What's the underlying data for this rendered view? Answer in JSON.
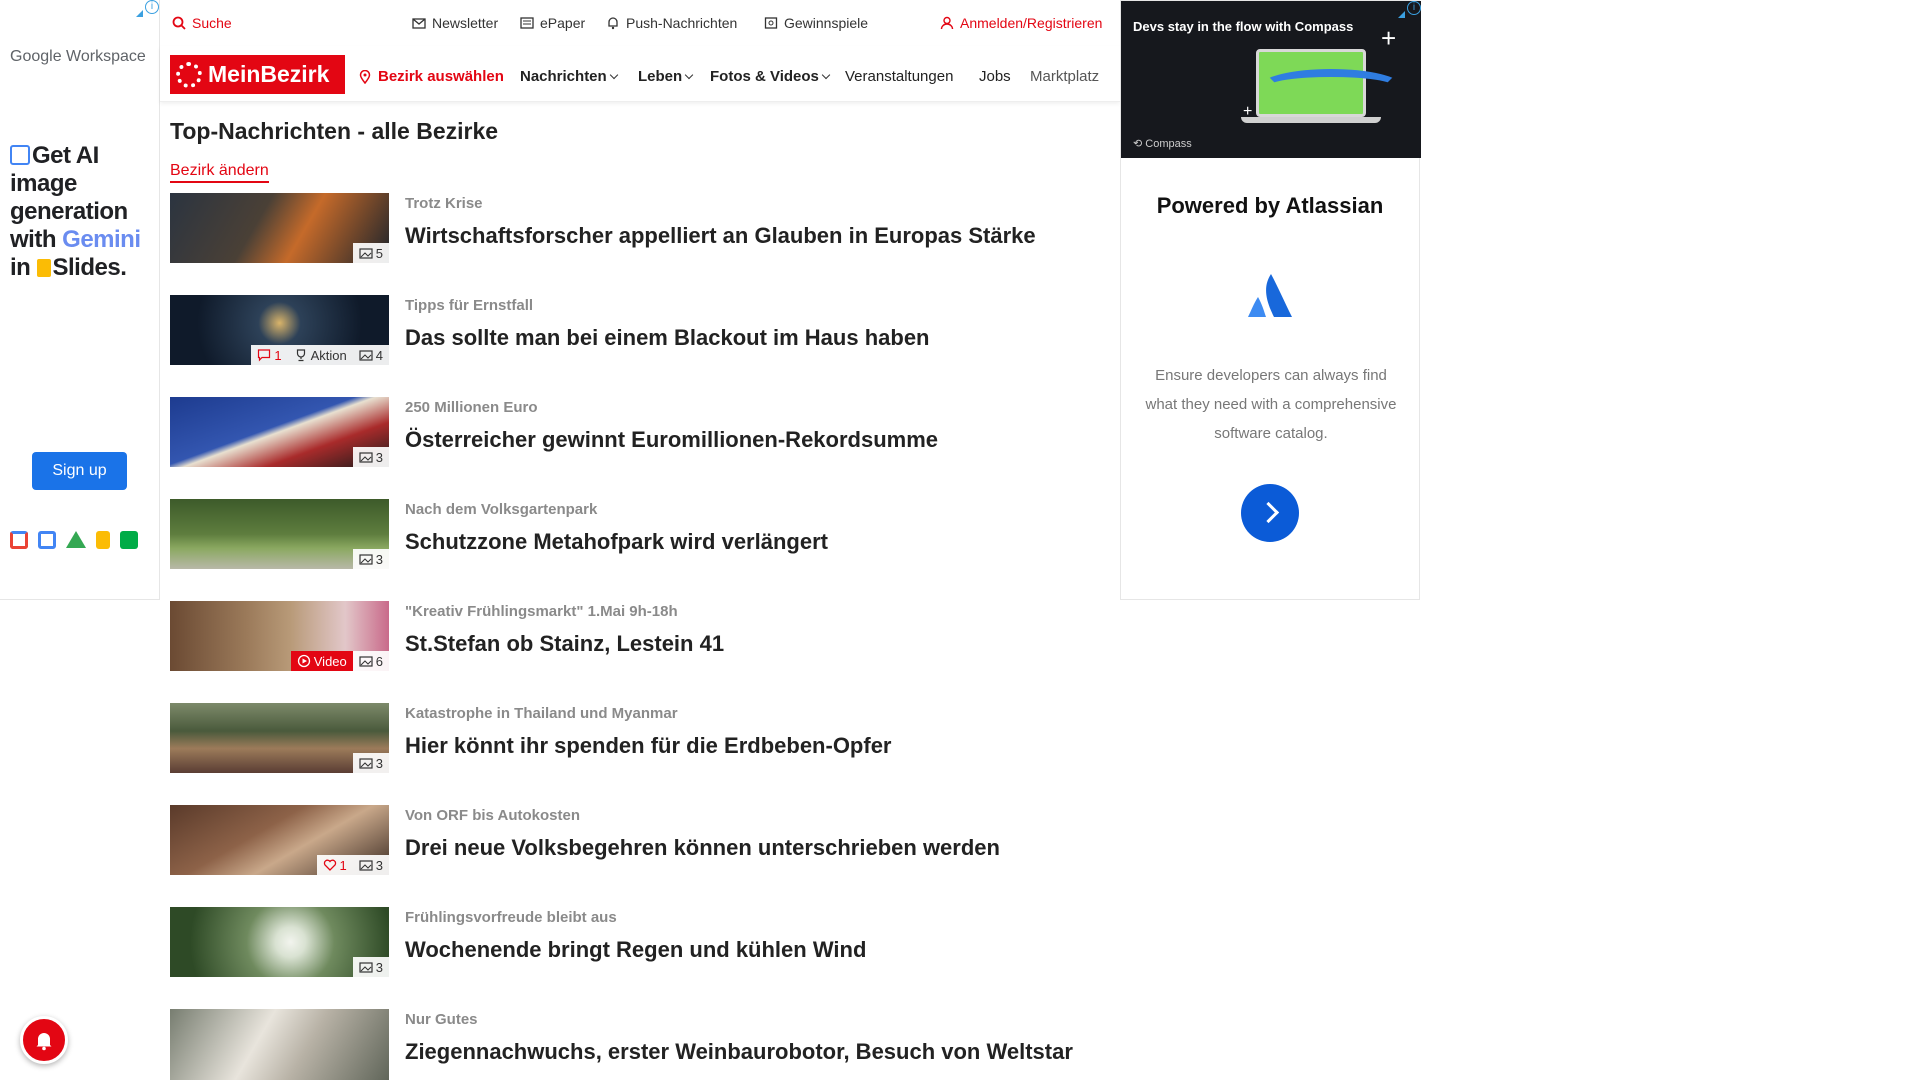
{
  "left_ad": {
    "brand": "Google Workspace",
    "headline_parts": [
      "Get AI image generation with ",
      "Gemini",
      " in ",
      "Slides."
    ],
    "cta": "Sign up",
    "apps": [
      "gmail",
      "calendar",
      "drive",
      "keep",
      "meet"
    ]
  },
  "topbar": {
    "search": "Suche",
    "newsletter": "Newsletter",
    "epaper": "ePaper",
    "push": "Push-Nachrichten",
    "games": "Gewinnspiele",
    "login": "Anmelden/Registrieren"
  },
  "nav": {
    "brand": "MeinBezirk",
    "district": "Bezirk auswählen",
    "items": [
      "Nachrichten",
      "Leben",
      "Fotos & Videos",
      "Veranstaltungen",
      "Jobs",
      "Marktplatz"
    ]
  },
  "page": {
    "title": "Top-Nachrichten - alle Bezirke",
    "change_link": "Bezirk ändern"
  },
  "articles": [
    {
      "kicker": "Trotz Krise",
      "headline": "Wirtschaftsforscher appelliert an Glauben in Europas Stärke",
      "photos": "5",
      "thumb_colors": [
        "#2b3440",
        "#c56a2a"
      ]
    },
    {
      "kicker": "Tipps für Ernstfall",
      "headline": "Das sollte man bei einem Blackout im Haus haben",
      "comments": "1",
      "action": "Aktion",
      "photos": "4",
      "thumb_colors": [
        "#0f1a2a",
        "#2d4158"
      ]
    },
    {
      "kicker": "250 Millionen Euro",
      "headline": "Österreicher gewinnt Euromillionen-Rekordsumme",
      "photos": "3",
      "thumb_colors": [
        "#1d3b8f",
        "#a92b2b"
      ]
    },
    {
      "kicker": "Nach dem Volksgartenpark",
      "headline": "Schutzzone Metahofpark wird verlängert",
      "photos": "3",
      "thumb_colors": [
        "#3d5a2a",
        "#8aa860"
      ]
    },
    {
      "kicker": "\"Kreativ Frühlingsmarkt\" 1.Mai 9h-18h",
      "headline": "St.Stefan ob Stainz, Lestein 41",
      "video": "Video",
      "photos": "6",
      "thumb_colors": [
        "#6b4a33",
        "#b89a78"
      ]
    },
    {
      "kicker": "Katastrophe in Thailand und Myanmar",
      "headline": "Hier könnt ihr spenden für die Erdbeben-Opfer",
      "photos": "3",
      "thumb_colors": [
        "#4a5a3c",
        "#9c7b5a"
      ]
    },
    {
      "kicker": "Von ORF bis Autokosten",
      "headline": "Drei neue Volksbegehren können unterschrieben werden",
      "likes": "1",
      "photos": "3",
      "thumb_colors": [
        "#5a3a2a",
        "#c9a88a"
      ]
    },
    {
      "kicker": "Frühlingsvorfreude bleibt aus",
      "headline": "Wochenende bringt Regen und kühlen Wind",
      "photos": "3",
      "thumb_colors": [
        "#2e4a26",
        "#d9e2d2"
      ]
    },
    {
      "kicker": "Nur Gutes",
      "headline": "Ziegennachwuchs, erster Weinbaurobotor, Besuch von Weltstar",
      "thumb_colors": [
        "#777d70",
        "#e8e4dc"
      ]
    }
  ],
  "right_ad": {
    "banner_text": "Devs stay in the flow with Compass",
    "banner_brand": "Compass",
    "title": "Powered by Atlassian",
    "body": "Ensure developers can always find what they need with a comprehensive software catalog."
  },
  "colors": {
    "brand_red": "#e30613",
    "atlassian_blue": "#0b5bd7"
  }
}
